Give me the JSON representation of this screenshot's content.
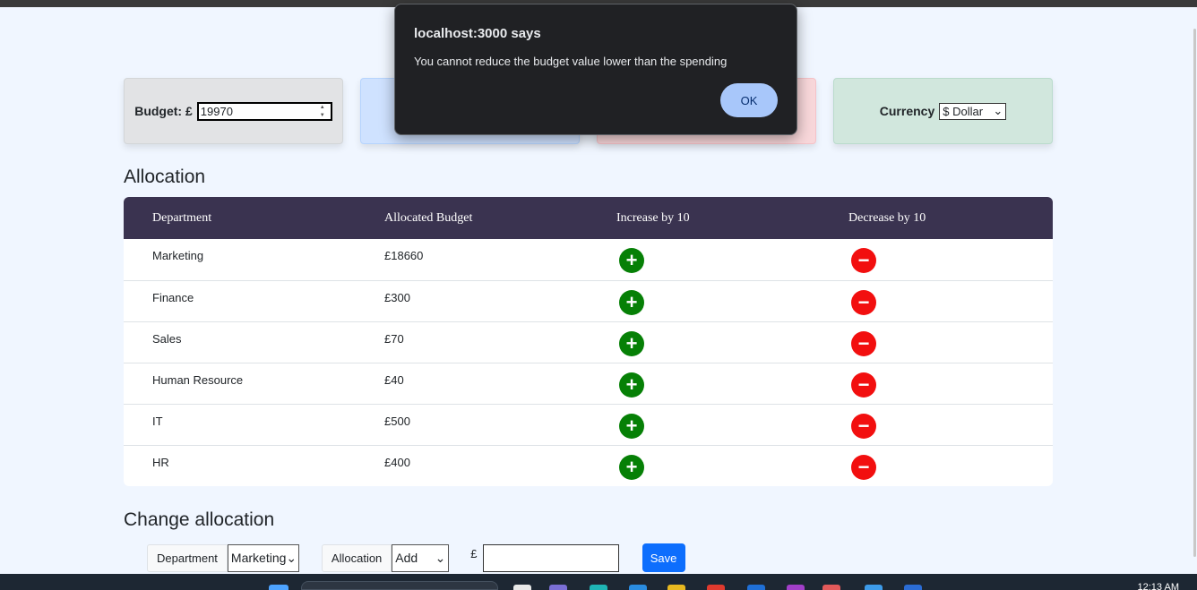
{
  "cards": {
    "budget": {
      "label": "Budget: £",
      "value": "19970"
    },
    "currency": {
      "label": "Currency",
      "selected": "$ Dollar"
    }
  },
  "allocation": {
    "title": "Allocation",
    "headers": [
      "Department",
      "Allocated Budget",
      "Increase by 10",
      "Decrease by 10"
    ],
    "rows": [
      {
        "department": "Marketing",
        "budget": "£18660"
      },
      {
        "department": "Finance",
        "budget": "£300"
      },
      {
        "department": "Sales",
        "budget": "£70"
      },
      {
        "department": "Human Resource",
        "budget": "£40"
      },
      {
        "department": "IT",
        "budget": "£500"
      },
      {
        "department": "HR",
        "budget": "£400"
      }
    ],
    "plus_symbol": "+",
    "minus_symbol": "−"
  },
  "change_allocation": {
    "title": "Change allocation",
    "department_label": "Department",
    "department_selected": "Marketing",
    "allocation_label": "Allocation",
    "allocation_selected": "Add",
    "currency_symbol": "£",
    "amount_value": "",
    "save_label": "Save"
  },
  "dialog": {
    "title": "localhost:3000 says",
    "message": "You cannot reduce the budget value lower than the spending",
    "ok_label": "OK"
  },
  "taskbar": {
    "time": "12:13 AM"
  },
  "colors": {
    "increase": "#068006",
    "decrease": "#f20f0f",
    "table_header": "#3a3350",
    "save": "#0d6efd",
    "dialog_button": "#a8c7fa"
  }
}
